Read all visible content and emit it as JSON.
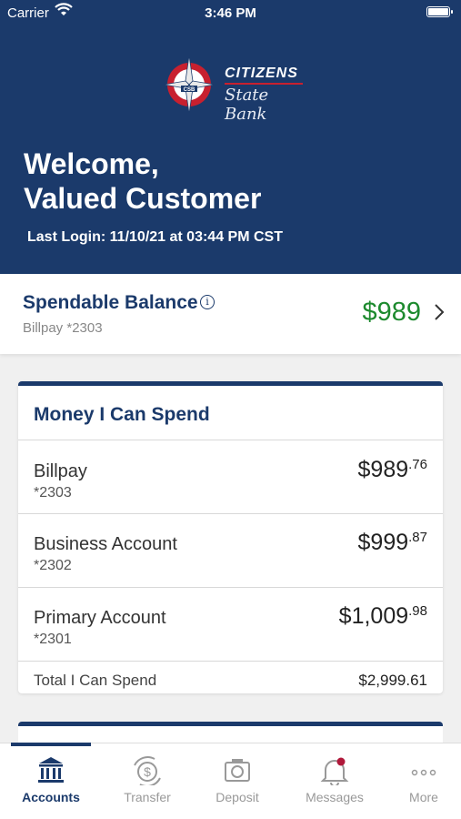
{
  "status_bar": {
    "carrier": "Carrier",
    "time": "3:46 PM"
  },
  "logo": {
    "citizens": "CITIZENS",
    "state_bank": "State Bank",
    "mark_text": "CSB"
  },
  "welcome": {
    "line1": "Welcome,",
    "line2": "Valued Customer"
  },
  "last_login": "Last Login: 11/10/21 at 03:44 PM CST",
  "spendable": {
    "title": "Spendable Balance",
    "info_glyph": "i",
    "subtitle": "Billpay *2303",
    "amount": "$989"
  },
  "money_card": {
    "title": "Money I Can Spend",
    "accounts": [
      {
        "name": "Billpay",
        "number": "*2303",
        "amount_main": "$989",
        "amount_cents": ".76"
      },
      {
        "name": "Business Account",
        "number": "*2302",
        "amount_main": "$999",
        "amount_cents": ".87"
      },
      {
        "name": "Primary Account",
        "number": "*2301",
        "amount_main": "$1,009",
        "amount_cents": ".98"
      }
    ],
    "total_label": "Total I Can Spend",
    "total_value": "$2,999.61"
  },
  "tabs": [
    {
      "label": "Accounts",
      "icon": "bank-icon",
      "active": true
    },
    {
      "label": "Transfer",
      "icon": "transfer-icon",
      "active": false
    },
    {
      "label": "Deposit",
      "icon": "camera-icon",
      "active": false
    },
    {
      "label": "Messages",
      "icon": "bell-icon",
      "active": false
    },
    {
      "label": "More",
      "icon": "more-icon",
      "active": false
    }
  ],
  "colors": {
    "brand_navy": "#1b3a6b",
    "brand_red": "#c8202f",
    "positive_green": "#1d8a2e",
    "tab_inactive": "#999999",
    "notification_dot": "#b0183a"
  }
}
